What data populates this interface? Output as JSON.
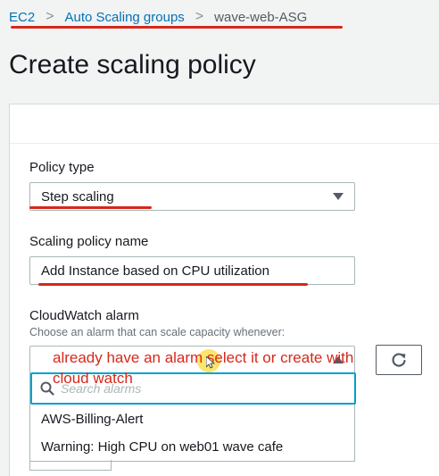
{
  "breadcrumb": {
    "items": [
      "EC2",
      "Auto Scaling groups"
    ],
    "current": "wave-web-ASG",
    "separator": ">"
  },
  "page": {
    "title": "Create scaling policy"
  },
  "form": {
    "policy_type": {
      "label": "Policy type",
      "value": "Step scaling"
    },
    "policy_name": {
      "label": "Scaling policy name",
      "value": "Add Instance based on CPU utilization"
    },
    "cloudwatch_alarm": {
      "label": "CloudWatch alarm",
      "description": "Choose an alarm that can scale capacity whenever:",
      "search_placeholder": "Search alarms",
      "options": [
        "AWS-Billing-Alert",
        "Warning: High CPU on web01 wave cafe"
      ]
    }
  },
  "annotation": {
    "text": "already have an alarm select it or create with cloud watch",
    "color": "#d6281c"
  },
  "colors": {
    "link": "#0073bb",
    "focus": "#00a1c9"
  },
  "icons": {
    "refresh": "refresh-icon",
    "search": "search-icon",
    "dropdown": "caret-down-icon"
  }
}
